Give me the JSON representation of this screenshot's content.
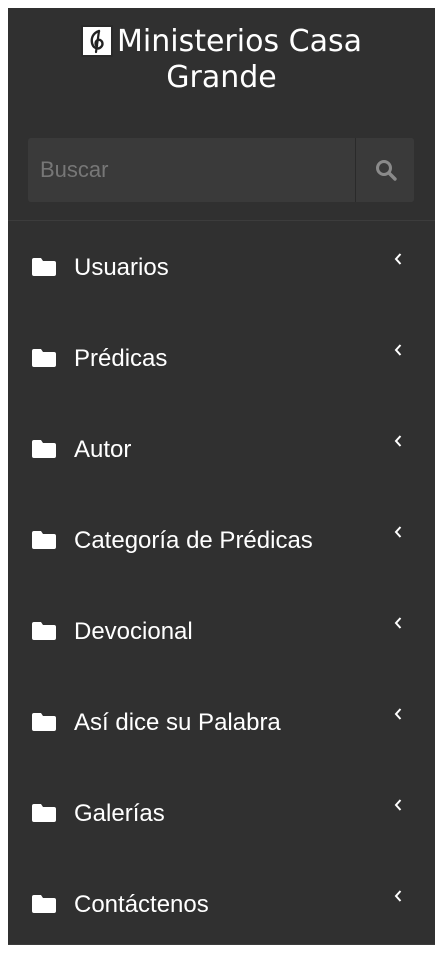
{
  "brand": {
    "title_line1": "Ministerios Casa",
    "title_line2": "Grande",
    "logo_icon": "music-note-logo-icon"
  },
  "search": {
    "placeholder": "Buscar",
    "value": "",
    "button_icon": "search-icon"
  },
  "menu": {
    "items": [
      {
        "label": "Usuarios",
        "icon": "folder-icon",
        "expand_icon": "chevron-left-icon"
      },
      {
        "label": "Prédicas",
        "icon": "folder-icon",
        "expand_icon": "chevron-left-icon"
      },
      {
        "label": "Autor",
        "icon": "folder-icon",
        "expand_icon": "chevron-left-icon"
      },
      {
        "label": "Categoría de Prédicas",
        "icon": "folder-icon",
        "expand_icon": "chevron-left-icon"
      },
      {
        "label": "Devocional",
        "icon": "folder-icon",
        "expand_icon": "chevron-left-icon"
      },
      {
        "label": "Así dice su Palabra",
        "icon": "folder-icon",
        "expand_icon": "chevron-left-icon"
      },
      {
        "label": "Galerías",
        "icon": "folder-icon",
        "expand_icon": "chevron-left-icon"
      },
      {
        "label": "Contáctenos",
        "icon": "folder-icon",
        "expand_icon": "chevron-left-icon"
      }
    ]
  },
  "colors": {
    "sidebar_bg": "#303030",
    "search_bg": "#3a3a3a",
    "text": "#ffffff",
    "placeholder": "#777777",
    "icon_muted": "#8a8a8a"
  }
}
